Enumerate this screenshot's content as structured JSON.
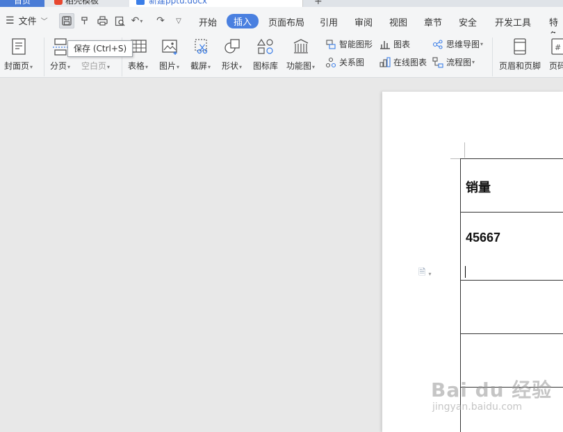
{
  "tabs": {
    "home": "首页",
    "template": "稻壳模板",
    "document": "新建pptu.docx",
    "plus": "+"
  },
  "menu": {
    "file": "文件",
    "tabs": [
      "开始",
      "插入",
      "页面布局",
      "引用",
      "审阅",
      "视图",
      "章节",
      "安全",
      "开发工具",
      "特色"
    ],
    "active_tab": "插入"
  },
  "ribbon": {
    "cover": "封面页",
    "page_break": "分页",
    "blank_page": "空白页",
    "table": "表格",
    "picture": "图片",
    "screenshot": "截屏",
    "shape": "形状",
    "icon_lib": "图标库",
    "func_chart": "功能图",
    "smart_art": "智能图形",
    "chart": "图表",
    "mind_map": "思维导图",
    "relation": "关系图",
    "online_chart": "在线图表",
    "flowchart": "流程图",
    "header_footer": "页眉和页脚",
    "page_number": "页码"
  },
  "tooltip": "保存 (Ctrl+S)",
  "document": {
    "cells": [
      "销量",
      "45667"
    ]
  },
  "watermark": {
    "logo": "Bai du 经验",
    "url": "jingyan.baidu.com"
  },
  "colors": {
    "accent": "#4a80e0",
    "ribbon_bg": "#f4f5f6",
    "workspace_bg": "#e8e8e8"
  }
}
